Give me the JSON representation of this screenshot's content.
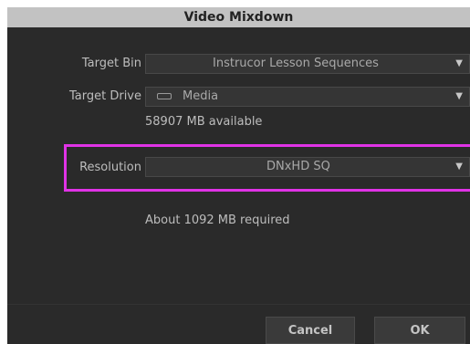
{
  "dialog": {
    "title": "Video Mixdown"
  },
  "fields": {
    "target_bin": {
      "label": "Target Bin",
      "value": "Instrucor Lesson Sequences"
    },
    "target_drive": {
      "label": "Target Drive",
      "value": "Media",
      "available": "58907 MB available"
    },
    "resolution": {
      "label": "Resolution",
      "value": "DNxHD SQ",
      "required": "About 1092 MB required"
    }
  },
  "buttons": {
    "cancel": "Cancel",
    "ok": "OK"
  },
  "icons": {
    "dropdown": "triangle-down-icon",
    "drive": "drive-icon"
  },
  "colors": {
    "highlight": "#e033e6",
    "background": "#2a2a2a",
    "titlebar": "#c2c2c2"
  }
}
